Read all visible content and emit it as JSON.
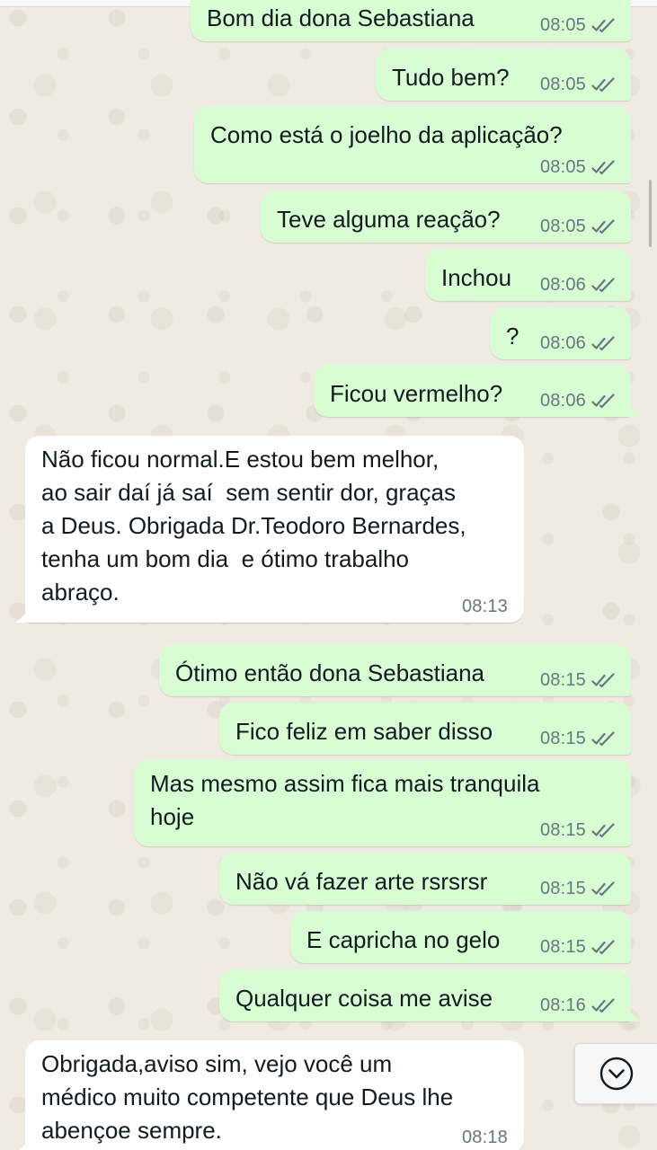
{
  "messages": [
    {
      "dir": "out",
      "text": "Bom dia dona Sebastiana",
      "time": "08:05",
      "read": true
    },
    {
      "dir": "out",
      "text": "Tudo bem?",
      "time": "08:05",
      "read": true
    },
    {
      "dir": "out",
      "text": "Como está o joelho da aplicação?",
      "time": "08:05",
      "read": true
    },
    {
      "dir": "out",
      "text": "Teve alguma reação?",
      "time": "08:05",
      "read": true
    },
    {
      "dir": "out",
      "text": "Inchou",
      "time": "08:06",
      "read": true
    },
    {
      "dir": "out",
      "text": "?",
      "time": "08:06",
      "read": true
    },
    {
      "dir": "out",
      "text": "Ficou vermelho?",
      "time": "08:06",
      "read": true
    },
    {
      "dir": "in",
      "text": "Não ficou normal.E estou bem melhor,\nao sair daí já saí  sem sentir dor, graças\na Deus. Obrigada Dr.Teodoro Bernardes,\ntenha um bom dia  e ótimo trabalho\nabraço.",
      "time": "08:13"
    },
    {
      "dir": "out",
      "text": "Ótimo então dona Sebastiana",
      "time": "08:15",
      "read": true
    },
    {
      "dir": "out",
      "text": "Fico feliz em saber disso",
      "time": "08:15",
      "read": true
    },
    {
      "dir": "out",
      "text": "Mas mesmo assim fica mais tranquila\nhoje",
      "time": "08:15",
      "read": true
    },
    {
      "dir": "out",
      "text": "Não vá fazer arte rsrsrsr",
      "time": "08:15",
      "read": true
    },
    {
      "dir": "out",
      "text": "E capricha no gelo",
      "time": "08:15",
      "read": true
    },
    {
      "dir": "out",
      "text": "Qualquer coisa me avise",
      "time": "08:16",
      "read": true
    },
    {
      "dir": "in",
      "text": "Obrigada,aviso sim, vejo você um\nmédico muito competente que Deus lhe\nabençoe sempre.",
      "time": "08:18"
    }
  ],
  "icons": {
    "read_receipt": "double-check-icon",
    "scroll_down": "chevron-down-icon"
  },
  "colors": {
    "outgoing_bubble": "#d9fdd3",
    "incoming_bubble": "#ffffff",
    "chat_background": "#efeae2",
    "timestamp": "#667781",
    "read_ticks": "#667781"
  }
}
